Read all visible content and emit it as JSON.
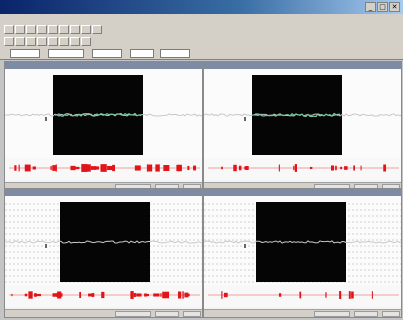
{
  "window": {
    "title": "",
    "controls": {
      "minimize": "_",
      "maximize": "□",
      "close": "✕"
    }
  },
  "menu": {
    "items": [
      "",
      "",
      "",
      "",
      "",
      "",
      "",
      "",
      "",
      ""
    ]
  },
  "toolbar": {
    "row1": [
      "",
      "",
      "",
      "",
      "",
      "",
      "",
      "",
      ""
    ],
    "row2": [
      "",
      "",
      "",
      "",
      "",
      "",
      "",
      ""
    ],
    "fields": [
      {
        "label": ""
      },
      {
        "label": ""
      },
      {
        "label": ""
      },
      {
        "label": ""
      },
      {
        "label": ""
      }
    ]
  },
  "colors": {
    "scope_bg": "#050505",
    "trace_gray": "#c8c8c8",
    "trace_green": "#77c7a0",
    "trace_red": "#e1141a",
    "trace_pink": "#f0a0a0"
  },
  "panels": [
    {
      "title": "",
      "trace_color": "green",
      "scope_x": 0.245,
      "strip_pattern": "dense",
      "grid": "none"
    },
    {
      "title": "",
      "trace_color": "green",
      "scope_x": 0.245,
      "strip_pattern": "sparse",
      "grid": "none"
    },
    {
      "title": "",
      "trace_color": "gray",
      "scope_x": 0.245,
      "strip_pattern": "dense",
      "grid": "dashed"
    },
    {
      "title": "",
      "trace_color": "gray",
      "scope_x": 0.245,
      "strip_pattern": "very-sparse",
      "grid": "dashed"
    }
  ]
}
